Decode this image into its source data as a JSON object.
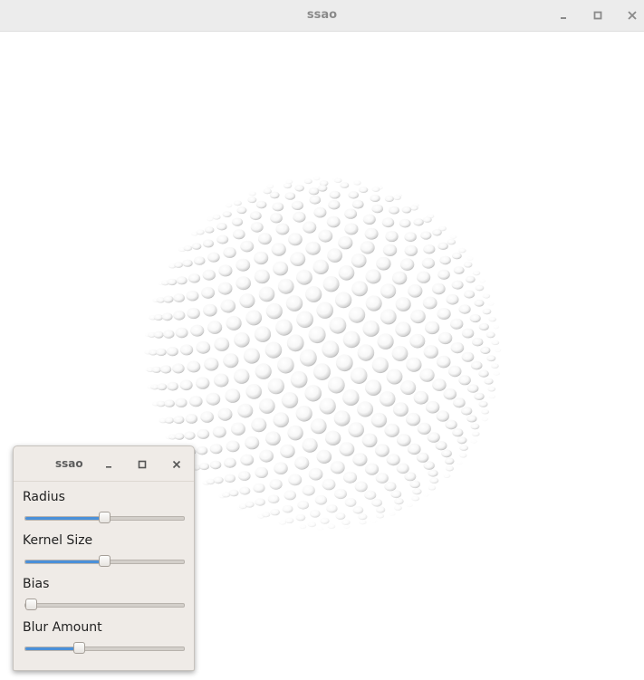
{
  "window": {
    "title": "ssao"
  },
  "titlebar_buttons": {
    "minimize_icon": "minimize-icon",
    "maximize_icon": "maximize-icon",
    "close_icon": "close-icon"
  },
  "panel": {
    "title": "ssao",
    "sliders": [
      {
        "label": "Radius",
        "value": 0.5
      },
      {
        "label": "Kernel Size",
        "value": 0.5
      },
      {
        "label": "Bias",
        "value": 0.0
      },
      {
        "label": "Blur Amount",
        "value": 0.34
      }
    ]
  },
  "colors": {
    "accent": "#4a90d9",
    "titlebar": "#ececec",
    "panel_bg": "#efebe7"
  }
}
